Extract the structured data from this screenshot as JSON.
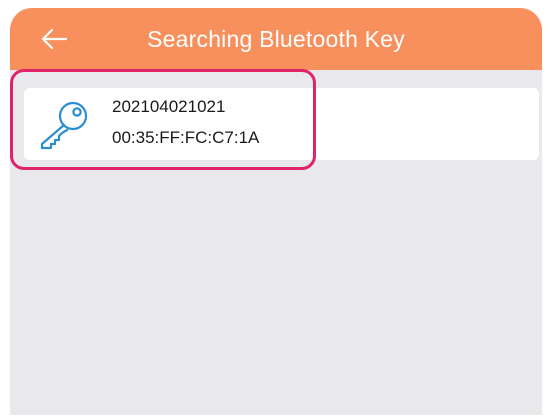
{
  "header": {
    "title": "Searching Bluetooth Key",
    "back_icon": "arrow-left-icon"
  },
  "devices": [
    {
      "name": "202104021021",
      "mac": "00:35:FF:FC:C7:1A",
      "icon": "key-icon"
    }
  ],
  "colors": {
    "header_bg": "#f8905e",
    "content_bg": "#e9e8ea",
    "icon_color": "#2a8fd0",
    "highlight": "#e0246c"
  }
}
